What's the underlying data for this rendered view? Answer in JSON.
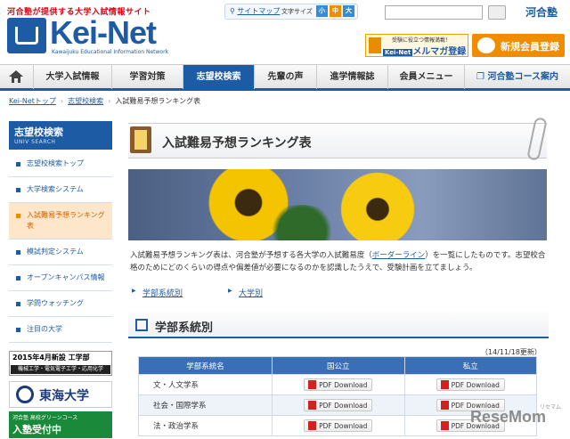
{
  "header": {
    "tagline": "河合塾が提供する大学入試情報サイト",
    "logo_text": "Kei-Net",
    "logo_sub": "Kawaijuku Educational Information Network",
    "sitemap": "サイトマップ",
    "fontsize_label": "文字サイズ",
    "font_sizes": [
      "小",
      "中",
      "大"
    ],
    "kawai_logo": "河合塾",
    "magazine_small": "受験に役立つ情報満載！",
    "magazine_big": "メルマガ登録",
    "member_label": "新規会員登録"
  },
  "nav": {
    "items": [
      "大学入試情報",
      "学習対策",
      "志望校検索",
      "先輩の声",
      "進学情報誌",
      "会員メニュー"
    ],
    "active": "志望校検索",
    "external": "河合塾コース案内"
  },
  "breadcrumb": [
    "Kei-Netトップ",
    "志望校検索",
    "入試難易予想ランキング表"
  ],
  "sidebar": {
    "title": "志望校検索",
    "subtitle": "UNIV SEARCH",
    "items": [
      {
        "label": "志望校検索トップ"
      },
      {
        "label": "大学検索システム"
      },
      {
        "label": "入試難易予想ランキング表"
      },
      {
        "label": "模試判定システム"
      },
      {
        "label": "オープンキャンパス情報"
      },
      {
        "label": "学問ウォッチング"
      },
      {
        "label": "注目の大学"
      }
    ],
    "ad_eng_top": "2015年4月新設 工学部",
    "ad_eng_bottom": "機械工学・電気電子工学・応用化学",
    "ad_tokai": "東海大学",
    "ad_green_top": "河合塾 高校グリーンコース",
    "ad_green_big": "入塾受付中"
  },
  "main": {
    "title": "入試難易予想ランキング表",
    "intro_a": "入試難易予想ランキング表は、河合塾が予想する各大学の入試難易度（",
    "intro_link": "ボーダーライン",
    "intro_b": "）を一覧にしたものです。志望校合格のためにどのくらいの得点や偏差値が必要になるのかを認識したうえで、受験計画を立てましょう。",
    "jump_links": [
      "学部系統別",
      "大学別"
    ],
    "section_title": "学部系統別",
    "updated": "（14/11/18更新）",
    "table": {
      "headers": [
        "学部系統名",
        "国公立",
        "私立"
      ],
      "rows": [
        {
          "name": "文・人文学系",
          "public": "PDF Download",
          "private": "PDF Download"
        },
        {
          "name": "社会・国際学系",
          "public": "PDF Download",
          "private": "PDF Download"
        },
        {
          "name": "法・政治学系",
          "public": "PDF Download",
          "private": "PDF Download"
        }
      ]
    }
  },
  "watermark": "ReseMom",
  "watermark_sub": "リセマム",
  "colors": {
    "brand": "#1d5ba5",
    "accent": "#e98c00",
    "table_header": "#3a6fb5"
  }
}
